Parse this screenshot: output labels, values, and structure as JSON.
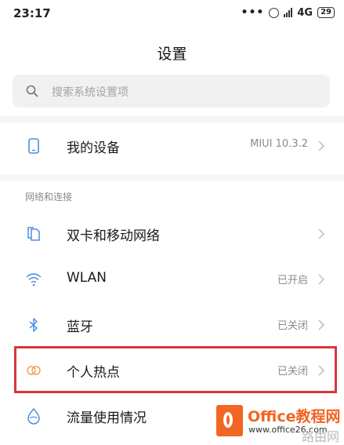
{
  "status_bar": {
    "time": "23:17",
    "dots": "•••",
    "network": "4G",
    "network_sub": "ᵍ",
    "battery": "29"
  },
  "page": {
    "title": "设置"
  },
  "search": {
    "placeholder": "搜索系统设置项"
  },
  "rows": {
    "my_device": {
      "label": "我的设备",
      "value": "MIUI 10.3.2",
      "icon": "phone-icon"
    },
    "dual_sim": {
      "label": "双卡和移动网络",
      "value": "",
      "icon": "sim-card-icon"
    },
    "wlan": {
      "label": "WLAN",
      "value": "已开启",
      "icon": "wifi-icon"
    },
    "bluetooth": {
      "label": "蓝牙",
      "value": "已关闭",
      "icon": "bluetooth-icon"
    },
    "hotspot": {
      "label": "个人热点",
      "value": "已关闭",
      "icon": "hotspot-icon"
    },
    "data_usage": {
      "label": "流量使用情况",
      "value": "",
      "icon": "data-drop-icon"
    }
  },
  "sections": {
    "network": "网络和连接"
  },
  "watermark": {
    "brand": "Office教程网",
    "url": "www.office26.com",
    "corner": "路由网"
  },
  "colors": {
    "accent_blue": "#4a8fdf",
    "highlight_red": "#d9363e",
    "hotspot_orange": "#f5a05a",
    "watermark_orange": "#f26522"
  }
}
